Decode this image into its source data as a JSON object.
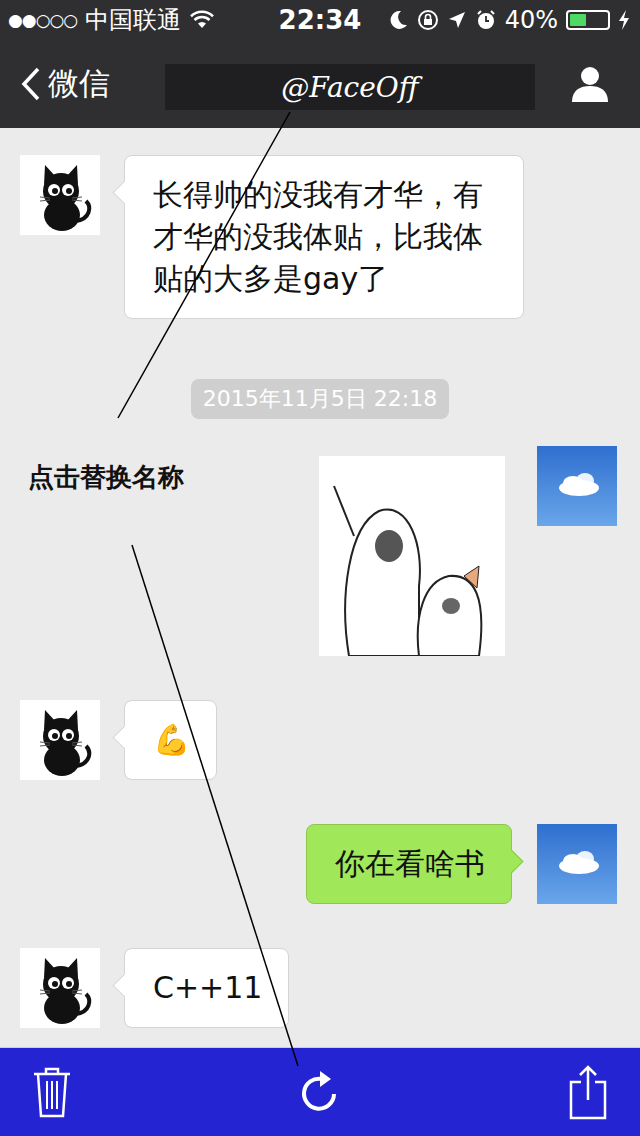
{
  "status_bar": {
    "signal": "●●○○○",
    "carrier": "中国联通",
    "time": "22:34",
    "battery": "40%",
    "battery_level": 0.4,
    "charging": true
  },
  "nav": {
    "back": "微信",
    "title": "@FaceOff"
  },
  "messages": [
    {
      "kind": "text",
      "side": "left",
      "text": "长得帅的没我有才华，有才华的没我体贴，比我体贴的大多是gay了"
    },
    {
      "kind": "timestamp",
      "side": "center",
      "text": "2015年11月5日 22:18"
    },
    {
      "kind": "sticker",
      "side": "right",
      "text": ""
    },
    {
      "kind": "text",
      "side": "left",
      "text": "💪"
    },
    {
      "kind": "text",
      "side": "right",
      "text": "你在看啥书"
    },
    {
      "kind": "text",
      "side": "left",
      "text": "C++11"
    }
  ],
  "annotation": {
    "label": "点击替换名称"
  }
}
